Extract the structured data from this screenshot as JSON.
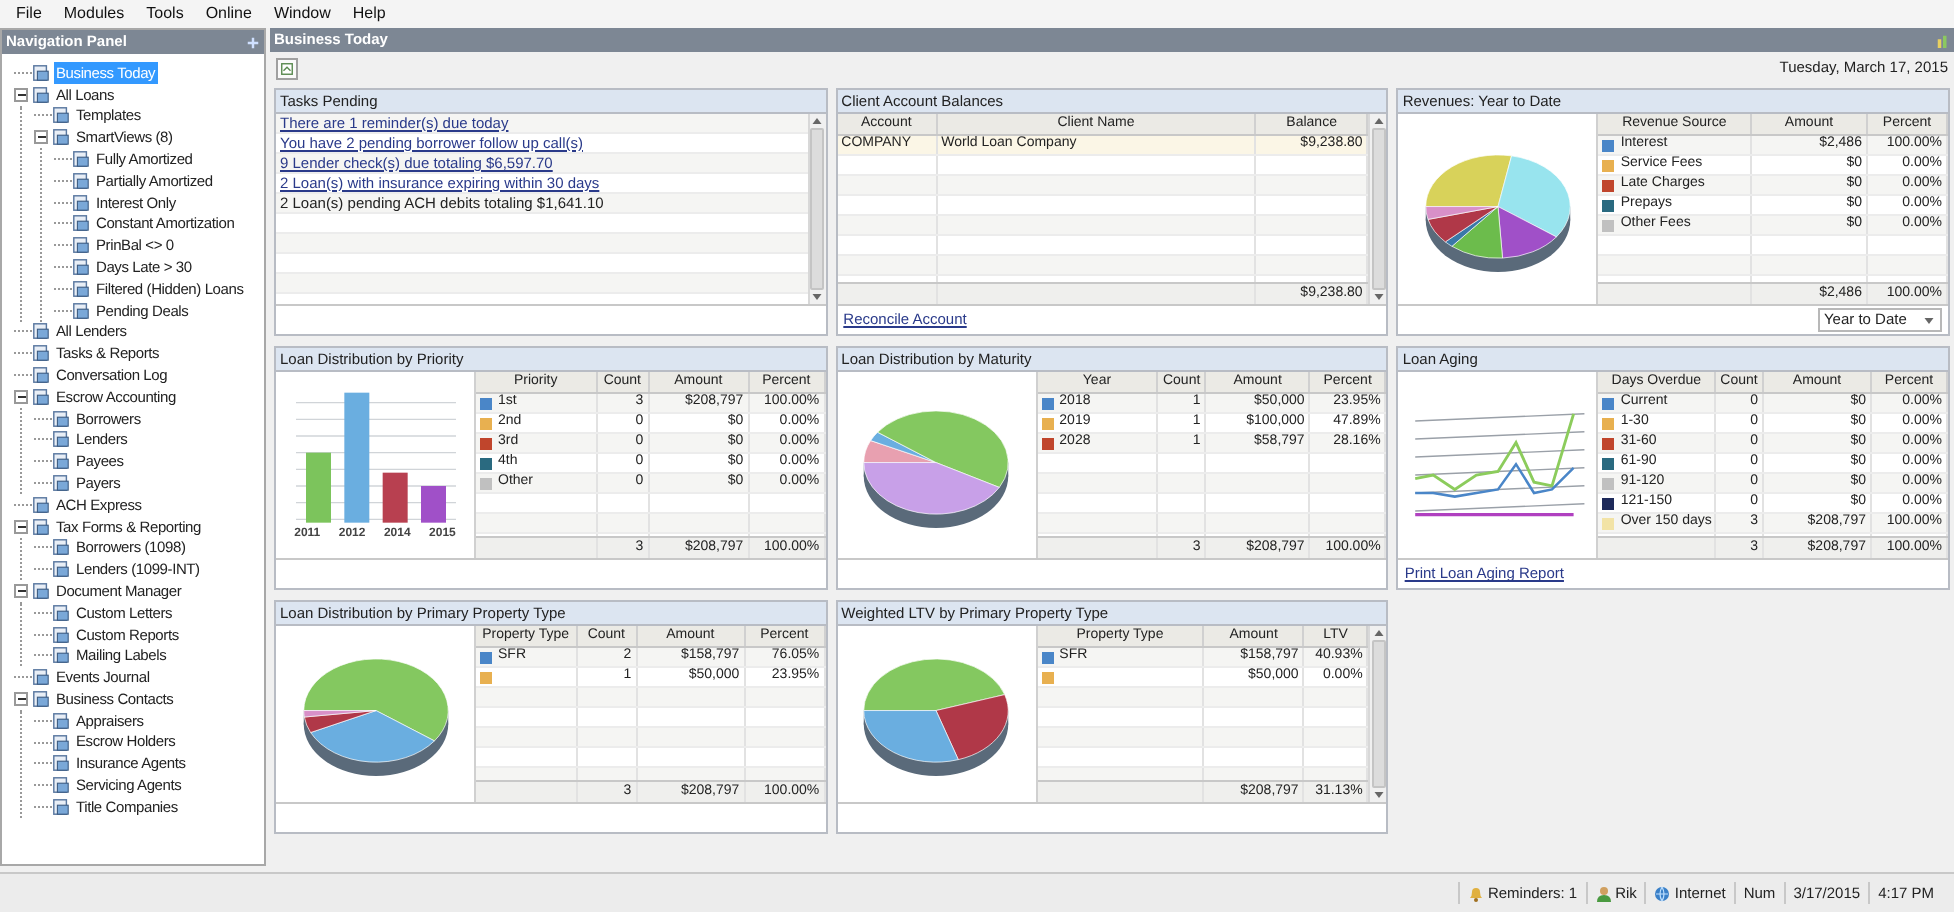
{
  "menu": [
    "File",
    "Modules",
    "Tools",
    "Online",
    "Window",
    "Help"
  ],
  "nav": {
    "title": "Navigation Panel",
    "items": [
      {
        "label": "Business Today",
        "selected": true
      },
      {
        "label": "All Loans",
        "selected": false,
        "expanded": true,
        "children": [
          {
            "label": "Templates",
            "selected": false
          },
          {
            "label": "SmartViews (8)",
            "selected": false,
            "expanded": true,
            "children": [
              {
                "label": "Fully Amortized",
                "selected": false
              },
              {
                "label": "Partially Amortized",
                "selected": false
              },
              {
                "label": "Interest Only",
                "selected": false
              },
              {
                "label": "Constant Amortization",
                "selected": false
              },
              {
                "label": "PrinBal <> 0",
                "selected": false
              },
              {
                "label": "Days Late > 30",
                "selected": false
              },
              {
                "label": "Filtered (Hidden) Loans",
                "selected": false
              },
              {
                "label": "Pending Deals",
                "selected": false
              }
            ]
          }
        ]
      },
      {
        "label": "All Lenders",
        "selected": false
      },
      {
        "label": "Tasks & Reports",
        "selected": false
      },
      {
        "label": "Conversation Log",
        "selected": false
      },
      {
        "label": "Escrow Accounting",
        "selected": false,
        "expanded": true,
        "children": [
          {
            "label": "Borrowers",
            "selected": false
          },
          {
            "label": "Lenders",
            "selected": false
          },
          {
            "label": "Payees",
            "selected": false
          },
          {
            "label": "Payers",
            "selected": false
          }
        ]
      },
      {
        "label": "ACH Express",
        "selected": false
      },
      {
        "label": "Tax Forms & Reporting",
        "selected": false,
        "expanded": true,
        "children": [
          {
            "label": "Borrowers (1098)",
            "selected": false
          },
          {
            "label": "Lenders (1099-INT)",
            "selected": false
          }
        ]
      },
      {
        "label": "Document Manager",
        "selected": false,
        "expanded": true,
        "children": [
          {
            "label": "Custom Letters",
            "selected": false
          },
          {
            "label": "Custom Reports",
            "selected": false
          },
          {
            "label": "Mailing Labels",
            "selected": false
          }
        ]
      },
      {
        "label": "Events Journal",
        "selected": false
      },
      {
        "label": "Business Contacts",
        "selected": false,
        "expanded": true,
        "children": [
          {
            "label": "Appraisers",
            "selected": false
          },
          {
            "label": "Escrow Holders",
            "selected": false
          },
          {
            "label": "Insurance Agents",
            "selected": false
          },
          {
            "label": "Servicing Agents",
            "selected": false
          },
          {
            "label": "Title Companies",
            "selected": false
          }
        ]
      }
    ]
  },
  "content": {
    "title": "Business Today",
    "date": "Tuesday, March 17, 2015"
  },
  "panels": [
    {
      "kind": "tasks",
      "title": "Tasks Pending",
      "scrollbar": true,
      "tasks": [
        {
          "kind": "link",
          "text": "There are 1 reminder(s) due today"
        },
        {
          "kind": "link",
          "text": "You have 2 pending borrower follow up call(s)"
        },
        {
          "kind": "link",
          "text": "9 Lender check(s) due totaling $6,597.70"
        },
        {
          "kind": "link",
          "text": "2 Loan(s) with insurance expiring within 30 days"
        },
        {
          "kind": "text",
          "text": "2 Loan(s) pending ACH debits totaling $1,641.10"
        }
      ]
    },
    {
      "kind": "grid",
      "title": "Client Account Balances",
      "scrollbar": true,
      "columns": [
        "Account",
        "Client Name",
        "Balance"
      ],
      "rows": [
        {
          "label": "COMPANY",
          "values": [
            "World Loan Company",
            "$9,238.80"
          ]
        }
      ],
      "totals": [
        "$9,238.80"
      ],
      "footer": {
        "kind": "link",
        "text": "Reconcile Account"
      }
    },
    {
      "kind": "grid",
      "title": "Revenues: Year to Date",
      "chart": {
        "kind": "pie"
      },
      "columns": [
        "Revenue Source",
        "Amount",
        "Percent"
      ],
      "rows": [
        {
          "label": "Interest",
          "values": [
            "$2,486",
            "100.00%"
          ],
          "color": "#4a86c8"
        },
        {
          "label": "Service Fees",
          "values": [
            "$0",
            "0.00%"
          ],
          "color": "#e8b050"
        },
        {
          "label": "Late Charges",
          "values": [
            "$0",
            "0.00%"
          ],
          "color": "#c0452c"
        },
        {
          "label": "Prepays",
          "values": [
            "$0",
            "0.00%"
          ],
          "color": "#2a6a80"
        },
        {
          "label": "Other Fees",
          "values": [
            "$0",
            "0.00%"
          ],
          "color": "#c0c0c0"
        }
      ],
      "totals": [
        "$2,486",
        "100.00%"
      ],
      "footer": {
        "kind": "dropdown",
        "value": "Year to Date"
      }
    },
    {
      "kind": "grid",
      "title": "Loan Distribution by Priority",
      "chart": {
        "kind": "bar",
        "labels": [
          "2011",
          "2012",
          "2014",
          "2015"
        ]
      },
      "columns": [
        "Priority",
        "Count",
        "Amount",
        "Percent"
      ],
      "rows": [
        {
          "label": "1st",
          "values": [
            "3",
            "$208,797",
            "100.00%"
          ],
          "color": "#4a86c8"
        },
        {
          "label": "2nd",
          "values": [
            "0",
            "$0",
            "0.00%"
          ],
          "color": "#e8b050"
        },
        {
          "label": "3rd",
          "values": [
            "0",
            "$0",
            "0.00%"
          ],
          "color": "#c0452c"
        },
        {
          "label": "4th",
          "values": [
            "0",
            "$0",
            "0.00%"
          ],
          "color": "#2a6a80"
        },
        {
          "label": "Other",
          "values": [
            "0",
            "$0",
            "0.00%"
          ],
          "color": "#c0c0c0"
        }
      ],
      "totals": [
        "3",
        "$208,797",
        "100.00%"
      ]
    },
    {
      "kind": "grid",
      "title": "Loan Distribution by Maturity",
      "chart": {
        "kind": "pie"
      },
      "columns": [
        "Year",
        "Count",
        "Amount",
        "Percent"
      ],
      "rows": [
        {
          "label": "2018",
          "values": [
            "1",
            "$50,000",
            "23.95%"
          ],
          "color": "#4a86c8"
        },
        {
          "label": "2019",
          "values": [
            "1",
            "$100,000",
            "47.89%"
          ],
          "color": "#e8b050"
        },
        {
          "label": "2028",
          "values": [
            "1",
            "$58,797",
            "28.16%"
          ],
          "color": "#c0452c"
        }
      ],
      "totals": [
        "3",
        "$208,797",
        "100.00%"
      ]
    },
    {
      "kind": "grid",
      "title": "Loan Aging",
      "chart": {
        "kind": "line"
      },
      "columns": [
        "Days Overdue",
        "Count",
        "Amount",
        "Percent"
      ],
      "rows": [
        {
          "label": "Current",
          "values": [
            "0",
            "$0",
            "0.00%"
          ],
          "color": "#4a86c8"
        },
        {
          "label": "1-30",
          "values": [
            "0",
            "$0",
            "0.00%"
          ],
          "color": "#e8b050"
        },
        {
          "label": "31-60",
          "values": [
            "0",
            "$0",
            "0.00%"
          ],
          "color": "#c0452c"
        },
        {
          "label": "61-90",
          "values": [
            "0",
            "$0",
            "0.00%"
          ],
          "color": "#2a6a80"
        },
        {
          "label": "91-120",
          "values": [
            "0",
            "$0",
            "0.00%"
          ],
          "color": "#c0c0c0"
        },
        {
          "label": "121-150",
          "values": [
            "0",
            "$0",
            "0.00%"
          ],
          "color": "#1e2a5a"
        },
        {
          "label": "Over 150 days",
          "values": [
            "3",
            "$208,797",
            "100.00%"
          ],
          "color": "#f2e3a6"
        }
      ],
      "totals": [
        "3",
        "$208,797",
        "100.00%"
      ],
      "footer": {
        "kind": "link",
        "text": "Print Loan Aging Report"
      }
    },
    {
      "kind": "grid",
      "title": "Loan Distribution by Primary Property Type",
      "chart": {
        "kind": "pie"
      },
      "columns": [
        "Property Type",
        "Count",
        "Amount",
        "Percent"
      ],
      "rows": [
        {
          "label": "SFR",
          "values": [
            "2",
            "$158,797",
            "76.05%"
          ],
          "color": "#4a86c8"
        },
        {
          "values": [
            "1",
            "$50,000",
            "23.95%"
          ],
          "color": "#e8b050"
        }
      ],
      "totals": [
        "3",
        "$208,797",
        "100.00%"
      ]
    },
    {
      "kind": "grid",
      "title": "Weighted LTV by Primary Property Type",
      "chart": {
        "kind": "pie"
      },
      "scrollbar": true,
      "columns": [
        "Property Type",
        "Amount",
        "LTV"
      ],
      "rows": [
        {
          "label": "SFR",
          "values": [
            "$158,797",
            "40.93%"
          ],
          "color": "#4a86c8"
        },
        {
          "values": [
            "$50,000",
            "0.00%"
          ],
          "color": "#e8b050"
        }
      ],
      "totals": [
        "$208,797",
        "31.13%"
      ]
    }
  ],
  "status_bar": [
    "Reminders: 1",
    "Rik",
    "Internet",
    "Num",
    "3/17/2015",
    "4:17 PM"
  ]
}
